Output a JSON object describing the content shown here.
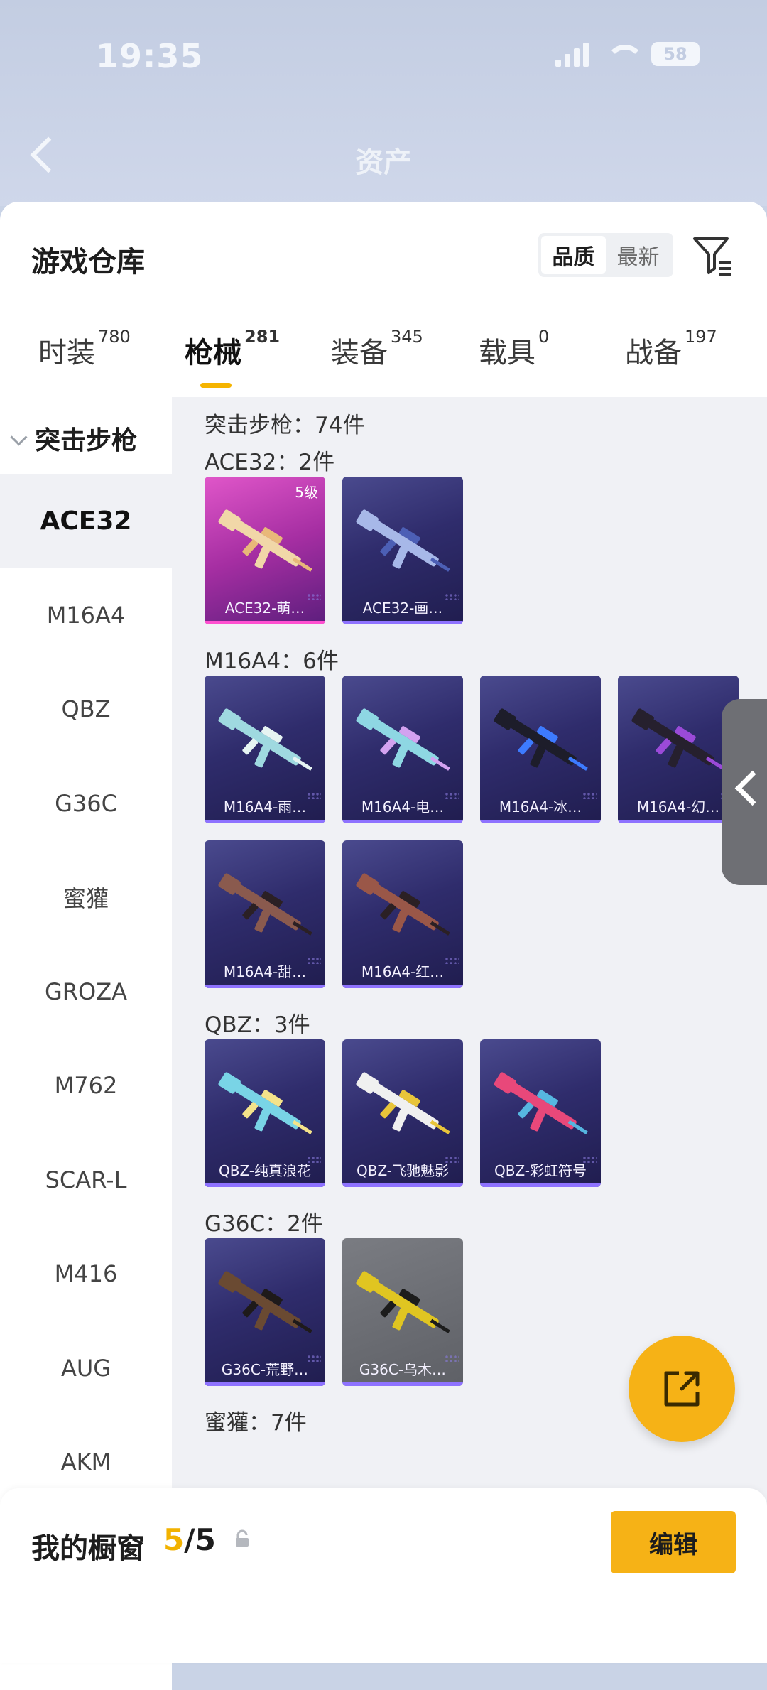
{
  "status": {
    "time": "19:35",
    "battery": "58"
  },
  "page": {
    "title": "资产"
  },
  "sheet": {
    "title": "游戏仓库",
    "sort": {
      "quality": "品质",
      "latest": "最新",
      "active": "quality"
    }
  },
  "tabs": [
    {
      "label": "时装",
      "count": "780"
    },
    {
      "label": "枪械",
      "count": "281",
      "active": true
    },
    {
      "label": "装备",
      "count": "345"
    },
    {
      "label": "载具",
      "count": "0"
    },
    {
      "label": "战备",
      "count": "197"
    }
  ],
  "sidebar": {
    "header": "突击步枪",
    "items": [
      "ACE32",
      "M16A4",
      "QBZ",
      "G36C",
      "蜜獾",
      "GROZA",
      "M762",
      "SCAR-L",
      "M416",
      "AUG",
      "AKM"
    ],
    "active_index": 0
  },
  "content": {
    "summary": "突击步枪：74件",
    "sections": [
      {
        "title": "ACE32：2件",
        "cards": [
          {
            "name": "ACE32-萌…",
            "level": "5级",
            "style": "pink"
          },
          {
            "name": "ACE32-画…",
            "style": "purple"
          }
        ]
      },
      {
        "title": "M16A4：6件",
        "cards": [
          {
            "name": "M16A4-雨…",
            "style": "purple"
          },
          {
            "name": "M16A4-电…",
            "style": "purple"
          },
          {
            "name": "M16A4-冰…",
            "style": "purple"
          },
          {
            "name": "M16A4-幻…",
            "style": "purple"
          },
          {
            "name": "M16A4-甜…",
            "style": "purple"
          },
          {
            "name": "M16A4-红…",
            "style": "purple"
          }
        ]
      },
      {
        "title": "QBZ：3件",
        "cards": [
          {
            "name": "QBZ-纯真浪花",
            "style": "purple"
          },
          {
            "name": "QBZ-飞驰魅影",
            "style": "purple"
          },
          {
            "name": "QBZ-彩虹符号",
            "style": "purple"
          }
        ]
      },
      {
        "title": "G36C：2件",
        "cards": [
          {
            "name": "G36C-荒野…",
            "style": "purple"
          },
          {
            "name": "G36C-乌木…",
            "style": "gray"
          }
        ]
      },
      {
        "title": "蜜獾：7件",
        "cards": []
      }
    ]
  },
  "showcase": {
    "label": "我的橱窗",
    "current": "5",
    "total": "/5",
    "edit": "编辑"
  },
  "colors": {
    "accent": "#f6b216",
    "card_purple": "#2f2c6c",
    "card_pink": "#c23db8"
  },
  "icons": [
    "filter-icon",
    "lock-icon",
    "share-icon",
    "back-icon",
    "expand-handle-icon"
  ]
}
